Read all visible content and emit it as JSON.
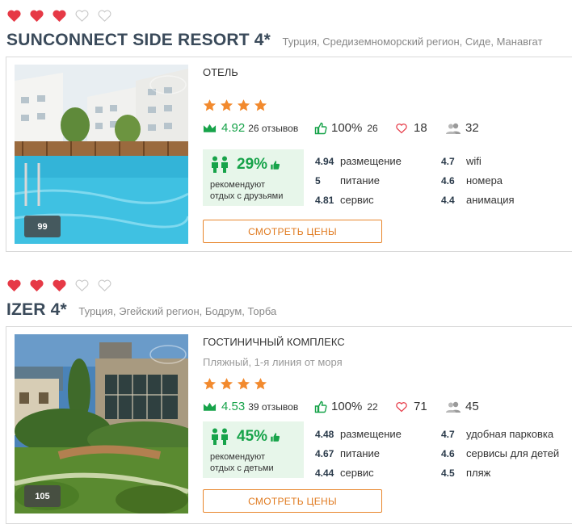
{
  "hotels": [
    {
      "name": "SUNCONNECT SIDE RESORT 4*",
      "location": "Турция, Средиземноморский регион, Сиде, Манавгат",
      "hearts_filled": 3,
      "hearts_total": 5,
      "type": "ОТЕЛЬ",
      "subtitle": "",
      "stars": 4,
      "rating": "4.92",
      "reviews": "26 отзывов",
      "recommend_pct": "100%",
      "recommend_count": "26",
      "likes": "18",
      "visitors": "32",
      "rec_percent": "29%",
      "rec_line1": "рекомендуют",
      "rec_line2": "отдых с друзьями",
      "photo_count": "99",
      "scores_left": [
        {
          "value": "4.94",
          "label": "размещение"
        },
        {
          "value": "5",
          "label": "питание"
        },
        {
          "value": "4.81",
          "label": "сервис"
        }
      ],
      "scores_right": [
        {
          "value": "4.7",
          "label": "wifi"
        },
        {
          "value": "4.6",
          "label": "номера"
        },
        {
          "value": "4.4",
          "label": "анимация"
        }
      ],
      "button": "СМОТРЕТЬ ЦЕНЫ"
    },
    {
      "name": "IZER 4*",
      "location": "Турция, Эгейский регион, Бодрум, Торба",
      "hearts_filled": 3,
      "hearts_total": 5,
      "type": "ГОСТИНИЧНЫЙ КОМПЛЕКС",
      "subtitle": "Пляжный, 1-я линия от моря",
      "stars": 4,
      "rating": "4.53",
      "reviews": "39 отзывов",
      "recommend_pct": "100%",
      "recommend_count": "22",
      "likes": "71",
      "visitors": "45",
      "rec_percent": "45%",
      "rec_line1": "рекомендуют",
      "rec_line2": "отдых с детьми",
      "photo_count": "105",
      "scores_left": [
        {
          "value": "4.48",
          "label": "размещение"
        },
        {
          "value": "4.67",
          "label": "питание"
        },
        {
          "value": "4.44",
          "label": "сервис"
        }
      ],
      "scores_right": [
        {
          "value": "4.7",
          "label": "удобная парковка"
        },
        {
          "value": "4.6",
          "label": "сервисы для детей"
        },
        {
          "value": "4.5",
          "label": "пляж"
        }
      ],
      "button": "СМОТРЕТЬ ЦЕНЫ"
    }
  ],
  "colors": {
    "heart": "#e63946",
    "star": "#f28a2e",
    "green": "#17a34a",
    "button": "#e8862c"
  },
  "icons": [
    "heart-icon",
    "star-icon",
    "crown-icon",
    "thumbs-up-icon",
    "heart-outline-icon",
    "users-icon",
    "family-icon"
  ]
}
